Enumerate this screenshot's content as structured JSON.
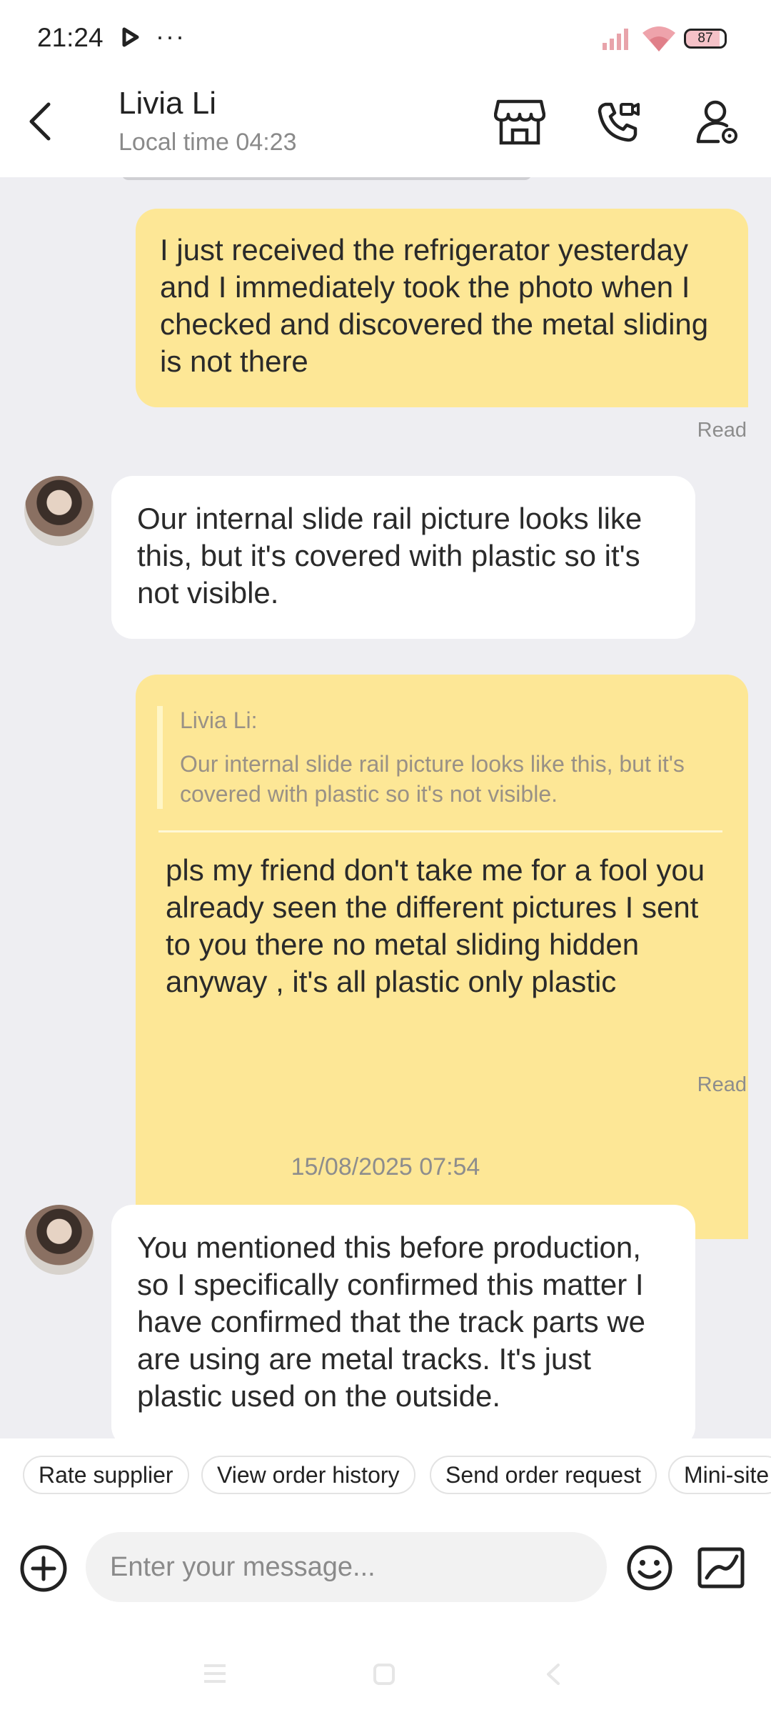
{
  "status_bar": {
    "time": "21:24",
    "more": "···",
    "battery": "87"
  },
  "header": {
    "name": "Livia Li",
    "local_time": "Local time 04:23"
  },
  "messages": {
    "m1": "I just received the refrigerator yesterday and I immediately took the photo when I checked and discovered the metal sliding is not there",
    "m1_status": "Read",
    "m2": "Our internal slide rail picture looks like this, but it's covered with plastic so it's not visible.",
    "m3_quote_name": "Livia Li:",
    "m3_quote_text": "Our internal slide rail picture looks like this, but it's covered with plastic so it's not visible.",
    "m3": "pls my friend don't take me for a fool you already seen the different pictures I sent to you there no metal sliding hidden anyway , it's all plastic only plastic",
    "m3_status": "Read",
    "date": "15/08/2025 07:54",
    "m4": "You mentioned this before production, so I specifically confirmed this matter I have confirmed that the track parts we are using are metal tracks. It's just plastic used on the outside."
  },
  "quick_actions": [
    "Rate supplier",
    "View order history",
    "Send order request",
    "Mini-site"
  ],
  "input": {
    "placeholder": "Enter your message..."
  },
  "colors": {
    "own_bubble": "#fde796",
    "other_bubble": "#ffffff",
    "chat_bg": "#eeeef2"
  }
}
